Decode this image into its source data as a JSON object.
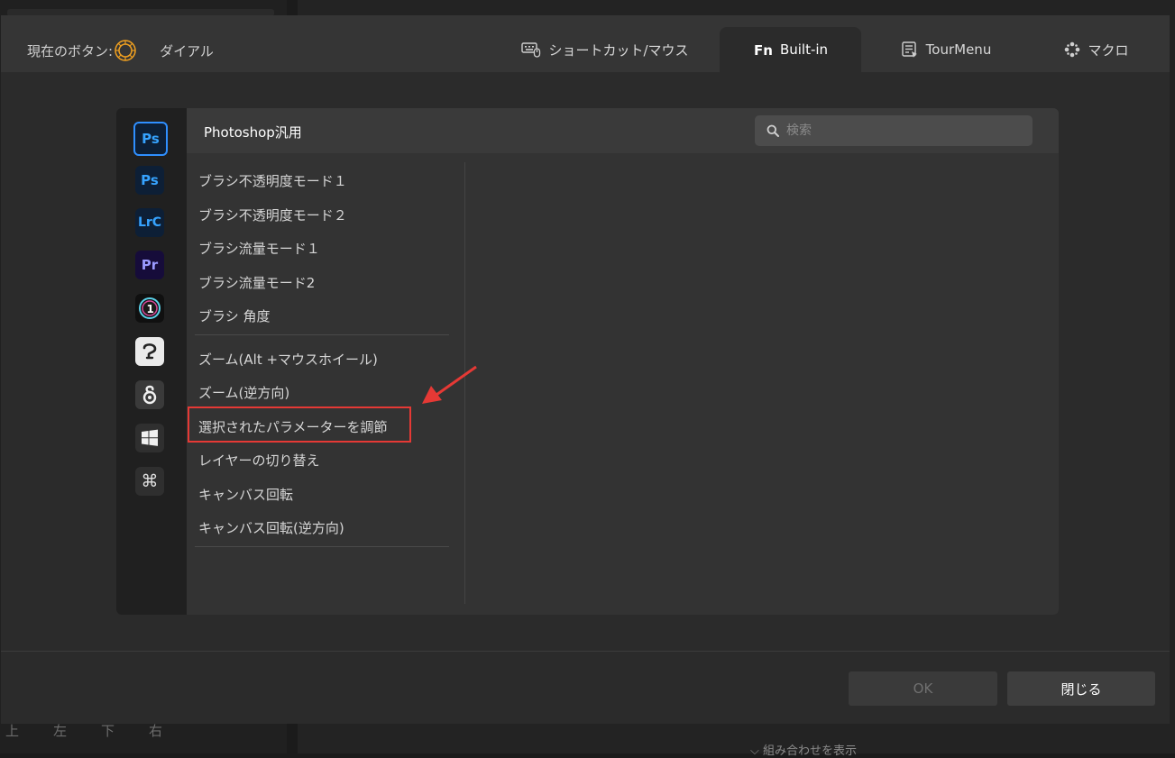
{
  "background": {
    "directions": [
      "上",
      "左",
      "下",
      "右"
    ],
    "combo_toggle": "組み合わせを表示"
  },
  "header": {
    "current_button_label": "現在のボタン:",
    "current_button_value": "ダイアル",
    "tabs": [
      {
        "label": "ショートカット/マウス",
        "icon": "keyboard-mouse-icon",
        "active": false
      },
      {
        "label": "Built-in",
        "icon": "fn-icon",
        "active": true
      },
      {
        "label": "TourMenu",
        "icon": "tourmenu-icon",
        "active": false
      },
      {
        "label": "マクロ",
        "icon": "macro-icon",
        "active": false
      }
    ]
  },
  "apps": [
    {
      "name": "Photoshop",
      "glyph": "Ps",
      "selected": true
    },
    {
      "name": "Photoshop",
      "glyph": "Ps",
      "selected": false
    },
    {
      "name": "Lightroom Classic",
      "glyph": "LrC",
      "selected": false
    },
    {
      "name": "Premiere Pro",
      "glyph": "Pr",
      "selected": false
    },
    {
      "name": "Capture One",
      "glyph": "",
      "selected": false
    },
    {
      "name": "Clip Studio Paint",
      "glyph": "",
      "selected": false
    },
    {
      "name": "Other app",
      "glyph": "",
      "selected": false
    },
    {
      "name": "Windows",
      "glyph": "",
      "selected": false
    },
    {
      "name": "Command",
      "glyph": "⌘",
      "selected": false
    }
  ],
  "panel": {
    "category_title": "Photoshop汎用",
    "search_placeholder": "検索",
    "functions": [
      "ブラシ不透明度モード１",
      "ブラシ不透明度モード２",
      "ブラシ流量モード１",
      "ブラシ流量モード2",
      "ブラシ 角度",
      "ズーム(Alt +マウスホイール)",
      "ズーム(逆方向)",
      "選択されたパラメーターを調節",
      "レイヤーの切り替え",
      "キャンバス回転",
      "キャンバス回転(逆方向)"
    ],
    "highlighted_function": "選択されたパラメーターを調節"
  },
  "footer": {
    "ok_label": "OK",
    "close_label": "閉じる"
  },
  "colors": {
    "accent_red": "#e53935",
    "photoshop_blue": "#36a3ff"
  }
}
